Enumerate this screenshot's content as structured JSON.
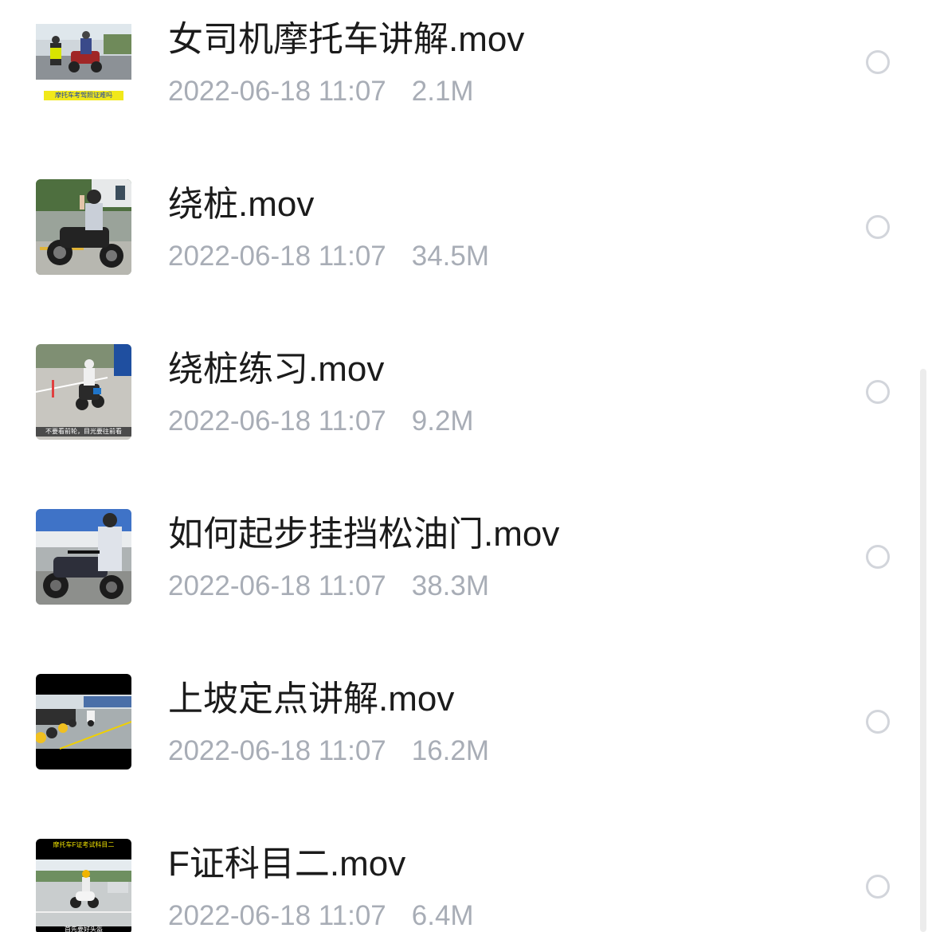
{
  "files": [
    {
      "name": "女司机摩托车讲解.mov",
      "date": "2022-06-18 11:07",
      "size": "2.1M",
      "thumb_caption": "摩托车考驾照证难吗",
      "thumbnail_icon": "video-thumbnail-female-rider"
    },
    {
      "name": "绕桩.mov",
      "date": "2022-06-18 11:07",
      "size": "34.5M",
      "thumbnail_icon": "video-thumbnail-rider-waving"
    },
    {
      "name": "绕桩练习.mov",
      "date": "2022-06-18 11:07",
      "size": "9.2M",
      "thumb_caption": "不要看前轮，目光要往前看",
      "thumbnail_icon": "video-thumbnail-pole-practice"
    },
    {
      "name": "如何起步挂挡松油门.mov",
      "date": "2022-06-18 11:07",
      "size": "38.3M",
      "thumbnail_icon": "video-thumbnail-starting-gear"
    },
    {
      "name": "上坡定点讲解.mov",
      "date": "2022-06-18 11:07",
      "size": "16.2M",
      "thumbnail_icon": "video-thumbnail-hill-start"
    },
    {
      "name": "F证科目二.mov",
      "date": "2022-06-18 11:07",
      "size": "6.4M",
      "thumb_caption_top": "摩托车F证考试科目二",
      "thumb_caption": "首先要好头盔",
      "thumbnail_icon": "video-thumbnail-scooter-test"
    }
  ],
  "colors": {
    "name_text": "#1b1b1b",
    "meta_text": "#a8adb6",
    "radio_border": "#d2d5db"
  }
}
